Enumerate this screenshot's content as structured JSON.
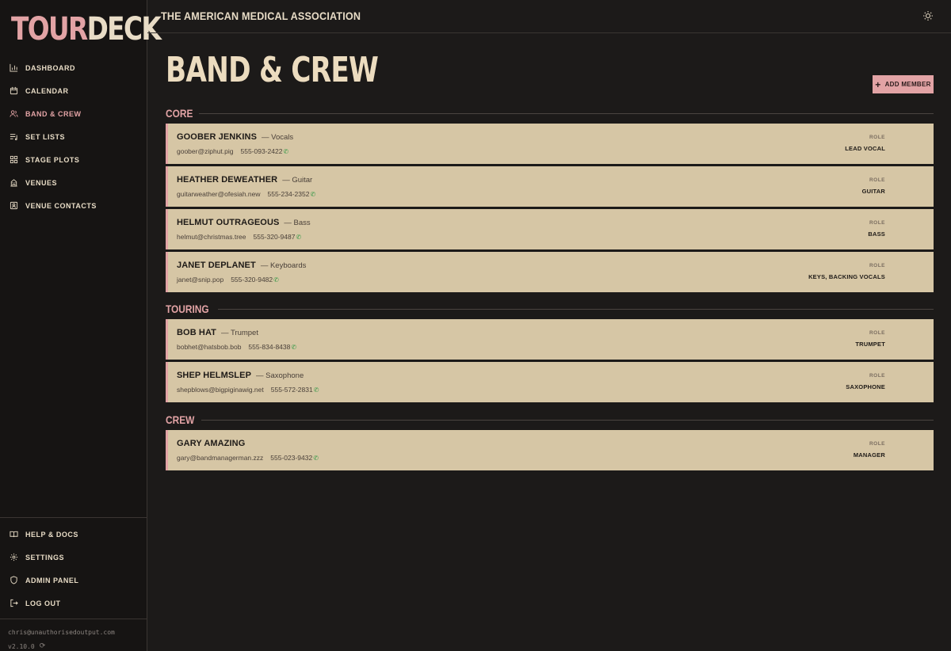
{
  "app": {
    "logo_a": "TOUR",
    "logo_b": "DECK"
  },
  "header": {
    "org_name": "THE AMERICAN MEDICAL ASSOCIATION",
    "theme_icon": "sun-icon"
  },
  "nav": {
    "items": [
      {
        "label": "DASHBOARD",
        "icon": "bar-chart-icon"
      },
      {
        "label": "CALENDAR",
        "icon": "calendar-icon"
      },
      {
        "label": "BAND & CREW",
        "icon": "users-icon",
        "active": true
      },
      {
        "label": "SET LISTS",
        "icon": "list-music-icon"
      },
      {
        "label": "STAGE PLOTS",
        "icon": "grid-icon"
      },
      {
        "label": "VENUES",
        "icon": "building-icon"
      },
      {
        "label": "VENUE CONTACTS",
        "icon": "contact-icon"
      }
    ],
    "bottom": [
      {
        "label": "HELP & DOCS",
        "icon": "book-icon"
      },
      {
        "label": "SETTINGS",
        "icon": "gear-icon"
      },
      {
        "label": "ADMIN PANEL",
        "icon": "shield-icon"
      },
      {
        "label": "LOG OUT",
        "icon": "logout-icon"
      }
    ],
    "user_email": "chris@unauthorisedoutput.com",
    "version": "v2.10.0"
  },
  "page": {
    "title": "BAND & CREW",
    "add_button": "ADD MEMBER",
    "role_label": "ROLE"
  },
  "sections": [
    {
      "title": "CORE",
      "members": [
        {
          "name": "GOOBER JENKINS",
          "instrument": "— Vocals",
          "email": "goober@ziphut.pig",
          "phone": "555-093-2422",
          "role": "LEAD VOCAL"
        },
        {
          "name": "HEATHER DEWEATHER",
          "instrument": "— Guitar",
          "email": "guitarweather@ofesiah.new",
          "phone": "555-234-2352",
          "role": "GUITAR"
        },
        {
          "name": "HELMUT OUTRAGEOUS",
          "instrument": "— Bass",
          "email": "helmut@christmas.tree",
          "phone": "555-320-9487",
          "role": "BASS"
        },
        {
          "name": "JANET DEPLANET",
          "instrument": "— Keyboards",
          "email": "janet@snip.pop",
          "phone": "555-320-9482",
          "role": "KEYS, BACKING VOCALS"
        }
      ]
    },
    {
      "title": "TOURING",
      "members": [
        {
          "name": "BOB HAT",
          "instrument": "— Trumpet",
          "email": "bobhet@hatsbob.bob",
          "phone": "555-834-8438",
          "role": "TRUMPET"
        },
        {
          "name": "SHEP HELMSLEP",
          "instrument": "— Saxophone",
          "email": "shepblows@bigpiginawig.net",
          "phone": "555-572-2831",
          "role": "SAXOPHONE"
        }
      ]
    },
    {
      "title": "CREW",
      "members": [
        {
          "name": "GARY AMAZING",
          "instrument": "",
          "email": "gary@bandmanagerman.zzz",
          "phone": "555-023-9432",
          "role": "MANAGER"
        }
      ]
    }
  ],
  "colors": {
    "accent": "#e2a3a5",
    "card": "#d6c6a5",
    "background": "#1c1a19",
    "phone": "#3a9a4a"
  }
}
